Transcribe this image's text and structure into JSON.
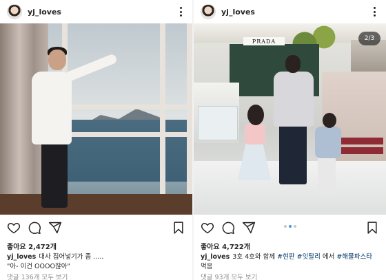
{
  "colors": {
    "hashtag": "#003569",
    "carousel_active_dot": "#3897f0",
    "muted_text": "#8e8e8e"
  },
  "posts": [
    {
      "username": "yj_loves",
      "likes": "좋아요 2,472개",
      "caption_line1": "대사 집어넣기가 좀 .....",
      "caption_line2": "\"아- 이건 OOOO잖아\"",
      "comments_link": "댓글 136개 모두 보기",
      "icons": [
        "more-options-icon",
        "heart-icon",
        "comment-icon",
        "share-icon",
        "bookmark-icon"
      ]
    },
    {
      "username": "yj_loves",
      "carousel_counter": "2/3",
      "store_sign": "PRADA",
      "likes": "좋아요 4,722개",
      "caption_segments": [
        "3호 4호와 함께 ",
        "#현판",
        " ",
        "#잇탈리",
        " 에서 ",
        "#해물파스타"
      ],
      "caption_line2": "먹음",
      "comments_link": "댓글 93개 모두 보기",
      "carousel": {
        "total": 3,
        "current": 2
      },
      "icons": [
        "more-options-icon",
        "heart-icon",
        "comment-icon",
        "share-icon",
        "bookmark-icon"
      ]
    }
  ]
}
